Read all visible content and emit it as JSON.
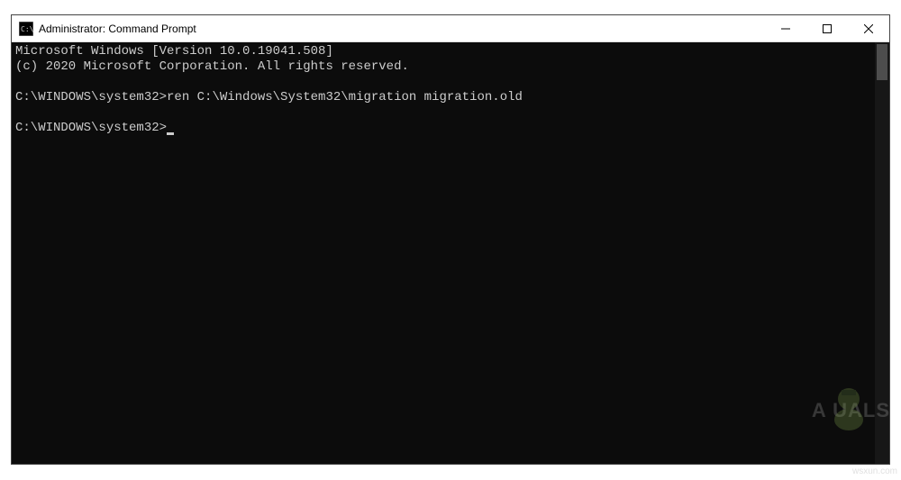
{
  "window": {
    "title": "Administrator: Command Prompt"
  },
  "terminal": {
    "line1": "Microsoft Windows [Version 10.0.19041.508]",
    "line2": "(c) 2020 Microsoft Corporation. All rights reserved.",
    "blank1": "",
    "prompt1": "C:\\WINDOWS\\system32>",
    "command1": "ren C:\\Windows\\System32\\migration migration.old",
    "blank2": "",
    "prompt2": "C:\\WINDOWS\\system32>"
  },
  "watermark": {
    "text": "wsxun.com",
    "logo_text": "A   UALS"
  }
}
